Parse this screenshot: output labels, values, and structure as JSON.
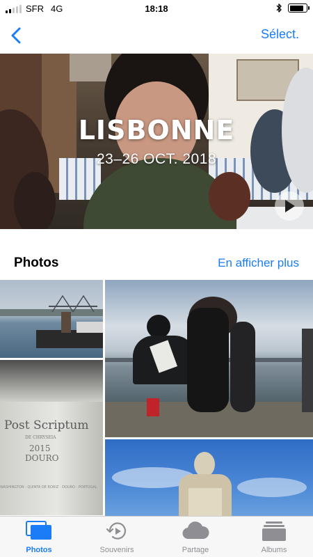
{
  "status_bar": {
    "carrier": "SFR",
    "network": "4G",
    "time": "18:18",
    "battery_level": 0.85,
    "signal_bars": 2
  },
  "nav": {
    "back_icon": "chevron-left-icon",
    "select_label": "Sélect."
  },
  "hero": {
    "title": "LISBONNE",
    "date_range": "23–26 OCT. 2018",
    "play_icon": "play-icon"
  },
  "photos_section": {
    "title": "Photos",
    "see_more_label": "En afficher plus"
  },
  "tab_bar": {
    "items": [
      {
        "label": "Photos",
        "icon": "photos-icon",
        "active": true
      },
      {
        "label": "Souvenirs",
        "icon": "memories-icon",
        "active": false
      },
      {
        "label": "Partage",
        "icon": "shared-cloud-icon",
        "active": false
      },
      {
        "label": "Albums",
        "icon": "albums-icon",
        "active": false
      }
    ]
  },
  "colors": {
    "accent": "#1a7cf6",
    "inactive": "#8e8e93",
    "tab_bar_bg": "#f7f7f7"
  }
}
